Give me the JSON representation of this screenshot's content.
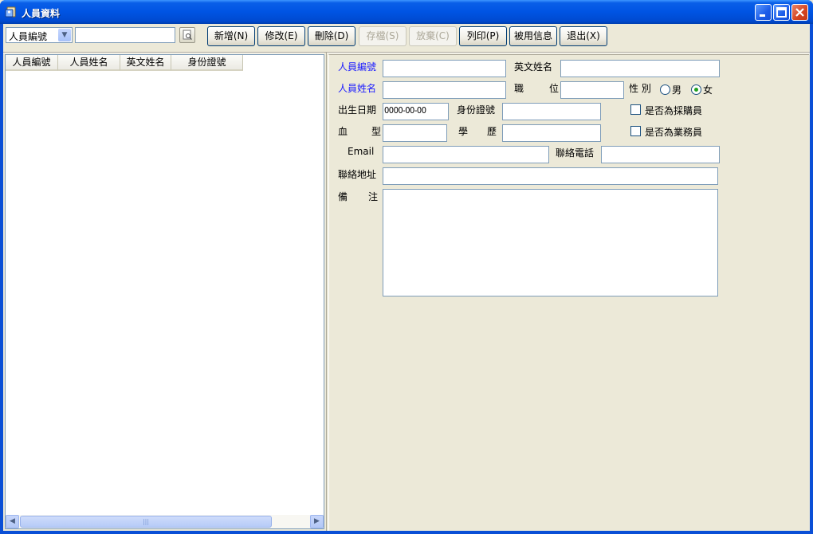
{
  "window": {
    "title": "人員資料",
    "accent": "#0054e3",
    "label_color": "#1a1aff"
  },
  "toolbar": {
    "search_field_select": "人員編號",
    "search_value": "",
    "buttons": {
      "new": "新增(N)",
      "edit": "修改(E)",
      "delete": "刪除(D)",
      "save": "存檔(S)",
      "cancel": "放棄(C)",
      "print": "列印(P)",
      "used_info": "被用信息",
      "exit": "退出(X)"
    }
  },
  "list": {
    "columns": [
      "人員編號",
      "人員姓名",
      "英文姓名",
      "身份證號"
    ],
    "rows": [],
    "scroll_grip": "|||"
  },
  "form": {
    "labels": {
      "emp_no": "人員編號",
      "eng_name": "英文姓名",
      "name": "人員姓名",
      "position_a": "職",
      "position_b": "位",
      "gender": "性 別",
      "male": "男",
      "female": "女",
      "birth_date": "出生日期",
      "id_no": "身份證號",
      "is_purchaser": "是否為採購員",
      "blood_a": "血",
      "blood_b": "型",
      "edu_a": "學",
      "edu_b": "歷",
      "is_sales": "是否為業務員",
      "email": "Email",
      "phone": "聯絡電話",
      "address": "聯絡地址",
      "notes_a": "備",
      "notes_b": "注"
    },
    "values": {
      "emp_no": "",
      "eng_name": "",
      "name": "",
      "position": "",
      "gender": "女",
      "birth_date": "0000-00-00",
      "id_no": "",
      "is_purchaser": false,
      "blood_type": "",
      "education": "",
      "is_sales": false,
      "email": "",
      "phone": "",
      "address": "",
      "notes": ""
    }
  }
}
